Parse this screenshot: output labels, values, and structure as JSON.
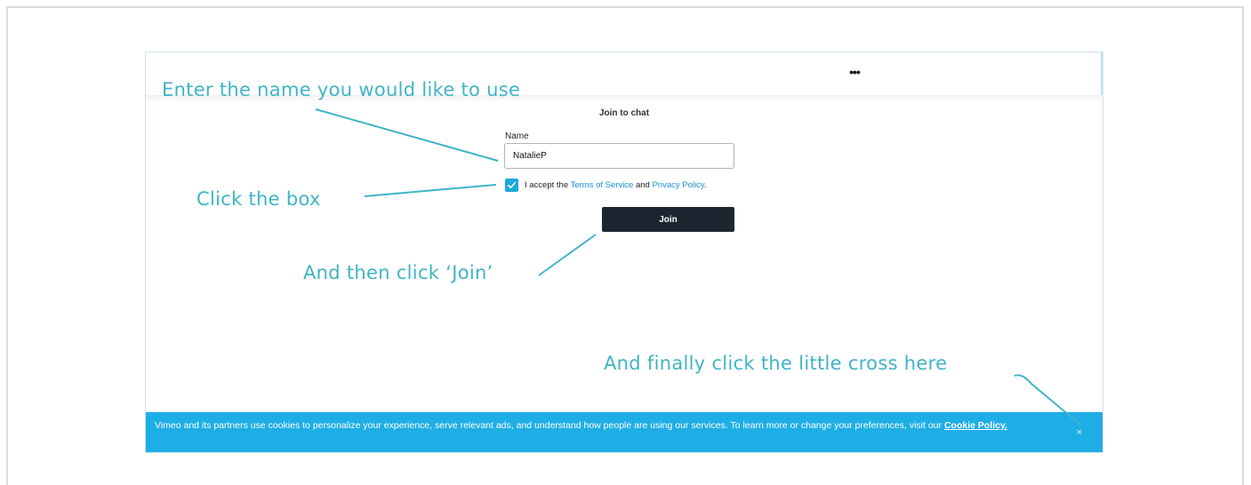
{
  "app": {
    "menu_icon": "ellipsis-icon",
    "menu_glyph": "•••"
  },
  "chat_form": {
    "title": "Join to chat",
    "name_label": "Name",
    "name_value": "NatalieP",
    "accept_prefix": "I accept the",
    "terms_link": "Terms of Service",
    "and_text": "and",
    "privacy_link": "Privacy Policy",
    "period": ".",
    "join_label": "Join",
    "checkbox_checked": true
  },
  "cookie_banner": {
    "text": "Vimeo and its partners use cookies to personalize your experience, serve relevant ads, and understand how people are using our services. To learn more or change your preferences, visit our",
    "link": "Cookie Policy.",
    "close_glyph": "×"
  },
  "annotations": {
    "enter_name": "Enter the name you would like to use",
    "click_box": "Click the box",
    "click_join": "And then click ‘Join’",
    "click_cross": "And finally click the little cross here"
  },
  "colors": {
    "annotation": "#3fb4c6",
    "cookie_banner": "#1eaee6",
    "join_button": "#1b2631",
    "link": "#1a8fd0",
    "checkbox": "#1fa9dc"
  }
}
